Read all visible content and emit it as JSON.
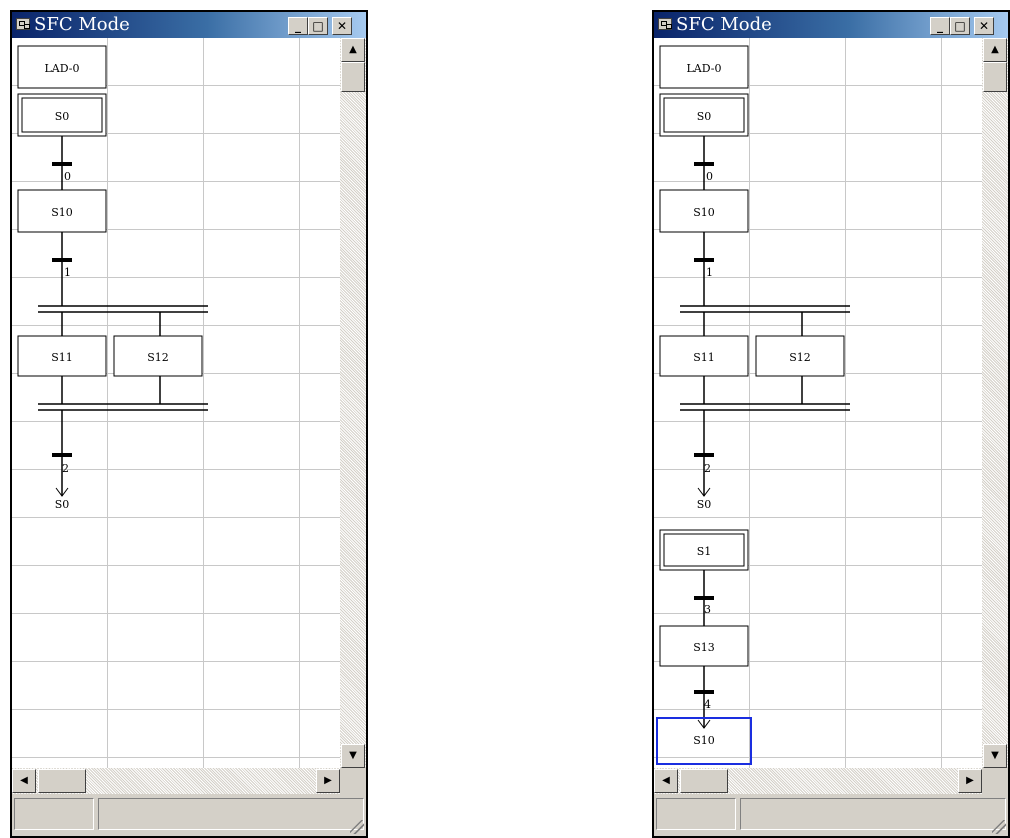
{
  "windows": [
    {
      "id": "left",
      "title": "SFC Mode",
      "steps": [
        "LAD-0",
        "S0",
        "S10",
        "S11",
        "S12"
      ],
      "transitions": [
        "0",
        "1",
        "2"
      ],
      "jumps": [
        "S0"
      ],
      "controls": {
        "minimize": "_",
        "maximize": "□",
        "close": "✕"
      },
      "scroll": {
        "up": "▲",
        "down": "▼",
        "left": "◀",
        "right": "▶"
      }
    },
    {
      "id": "right",
      "title": "SFC Mode",
      "steps": [
        "LAD-0",
        "S0",
        "S10",
        "S11",
        "S12",
        "S1",
        "S13"
      ],
      "transitions": [
        "0",
        "1",
        "2",
        "3",
        "4"
      ],
      "jumps": [
        "S0",
        "S10"
      ],
      "selected_jump": "S10",
      "controls": {
        "minimize": "_",
        "maximize": "□",
        "close": "✕"
      },
      "scroll": {
        "up": "▲",
        "down": "▼",
        "left": "◀",
        "right": "▶"
      }
    }
  ],
  "colors": {
    "selection": "#1a2ee0",
    "titlebar": "#0a246a"
  }
}
